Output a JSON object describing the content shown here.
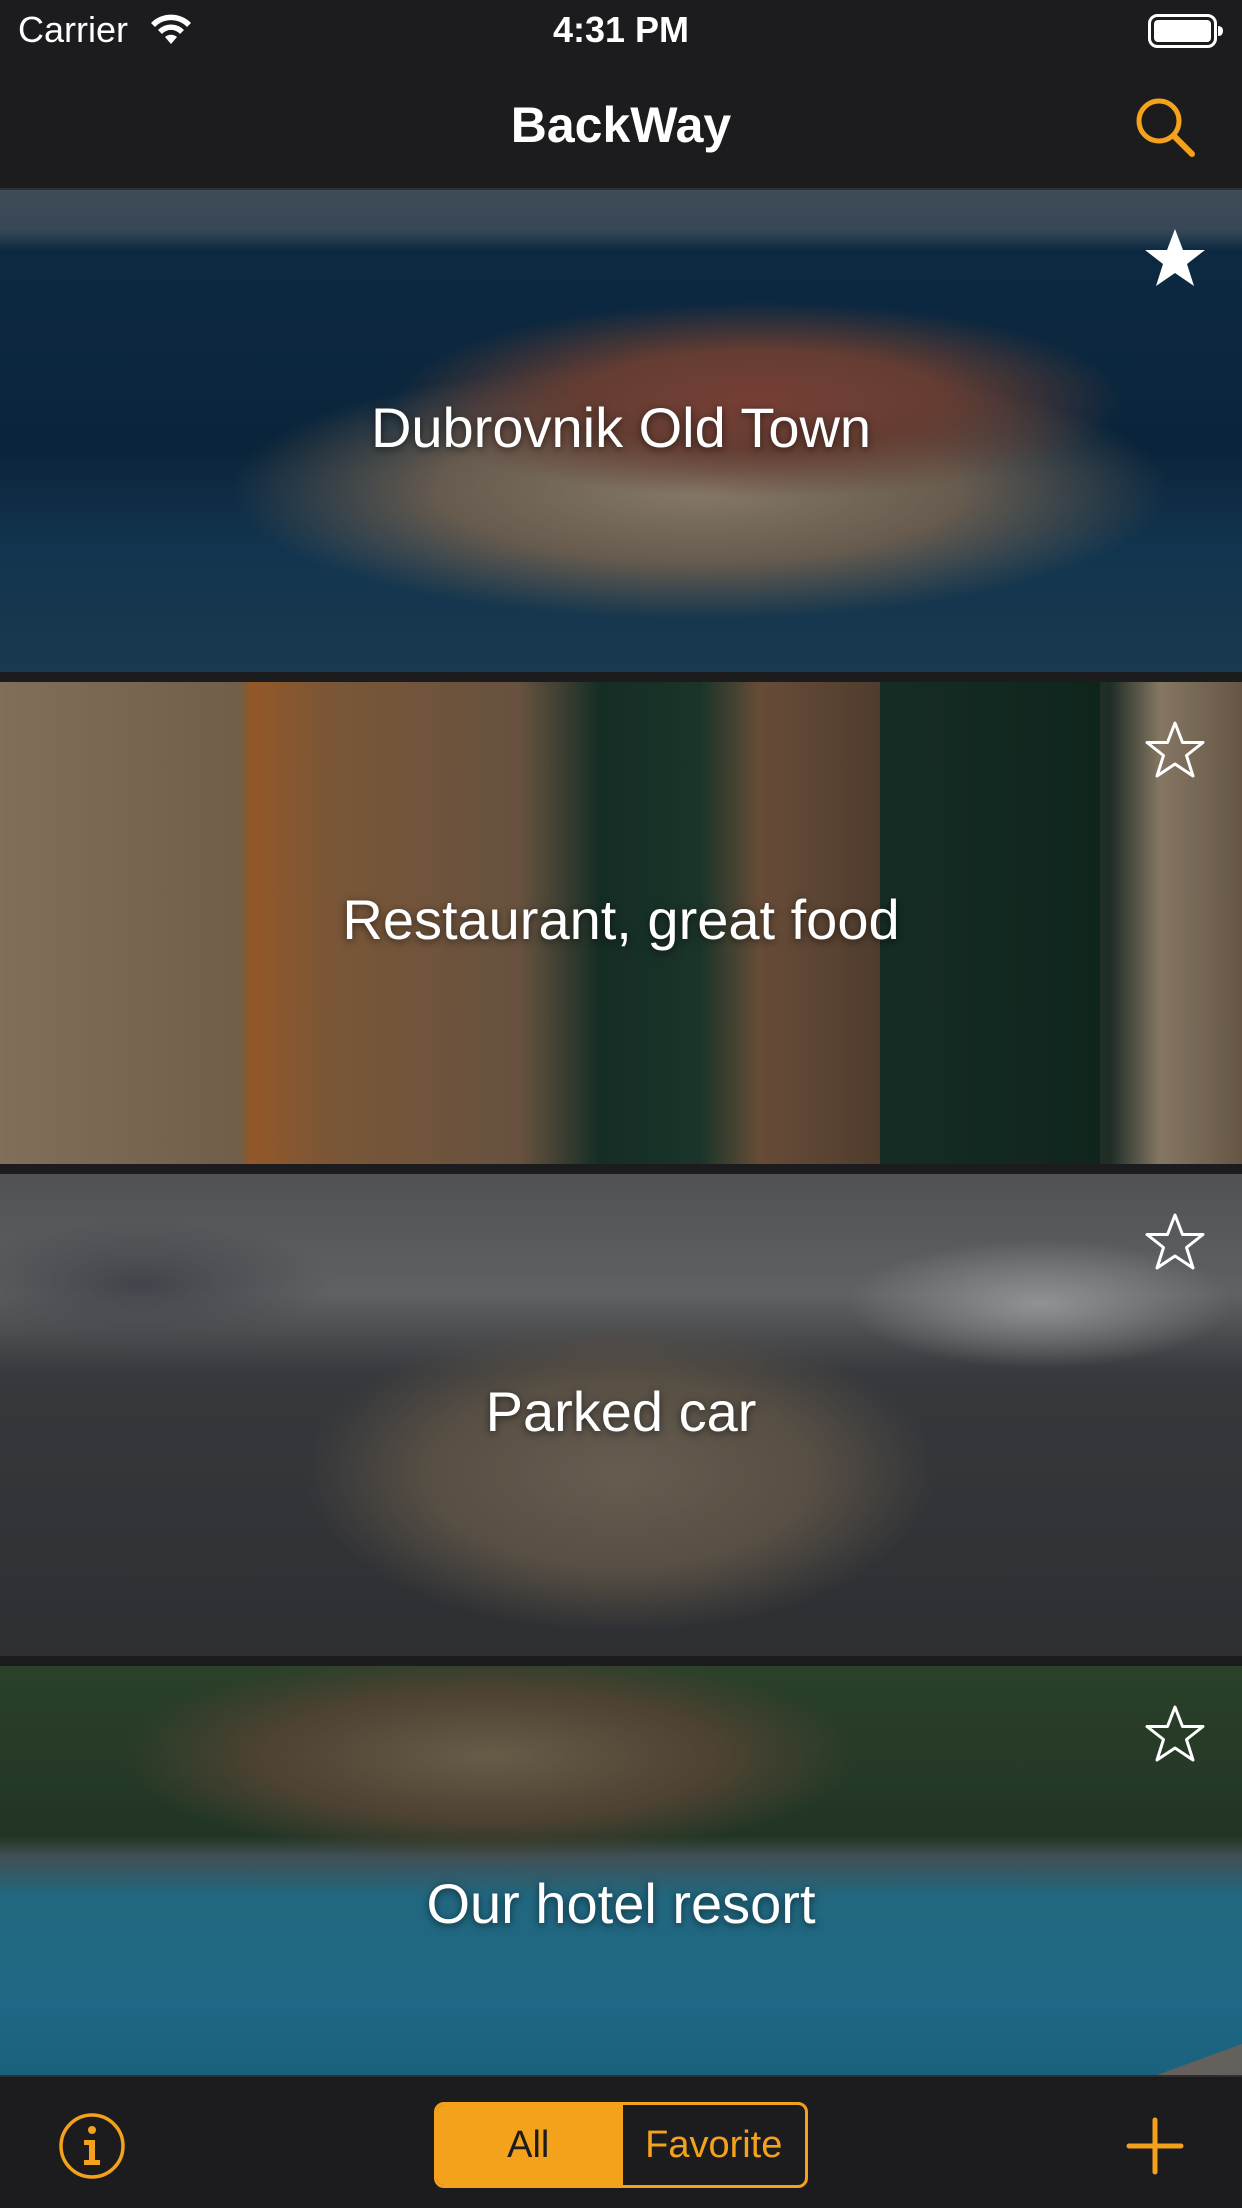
{
  "status_bar": {
    "carrier": "Carrier",
    "time": "4:31 PM",
    "wifi_icon": "wifi-icon",
    "battery_icon": "battery-icon"
  },
  "nav": {
    "title": "BackWay",
    "search_icon": "search-icon"
  },
  "colors": {
    "accent": "#f4a11c",
    "background": "#1c1c1e",
    "text": "#ffffff"
  },
  "places": [
    {
      "title": "Dubrovnik Old Town",
      "favorite": true
    },
    {
      "title": "Restaurant, great food",
      "favorite": false
    },
    {
      "title": "Parked car",
      "favorite": false
    },
    {
      "title": "Our hotel resort",
      "favorite": false
    }
  ],
  "toolbar": {
    "info_icon": "info-icon",
    "segments": [
      "All",
      "Favorite"
    ],
    "selected_segment": "All",
    "add_icon": "plus-icon"
  }
}
